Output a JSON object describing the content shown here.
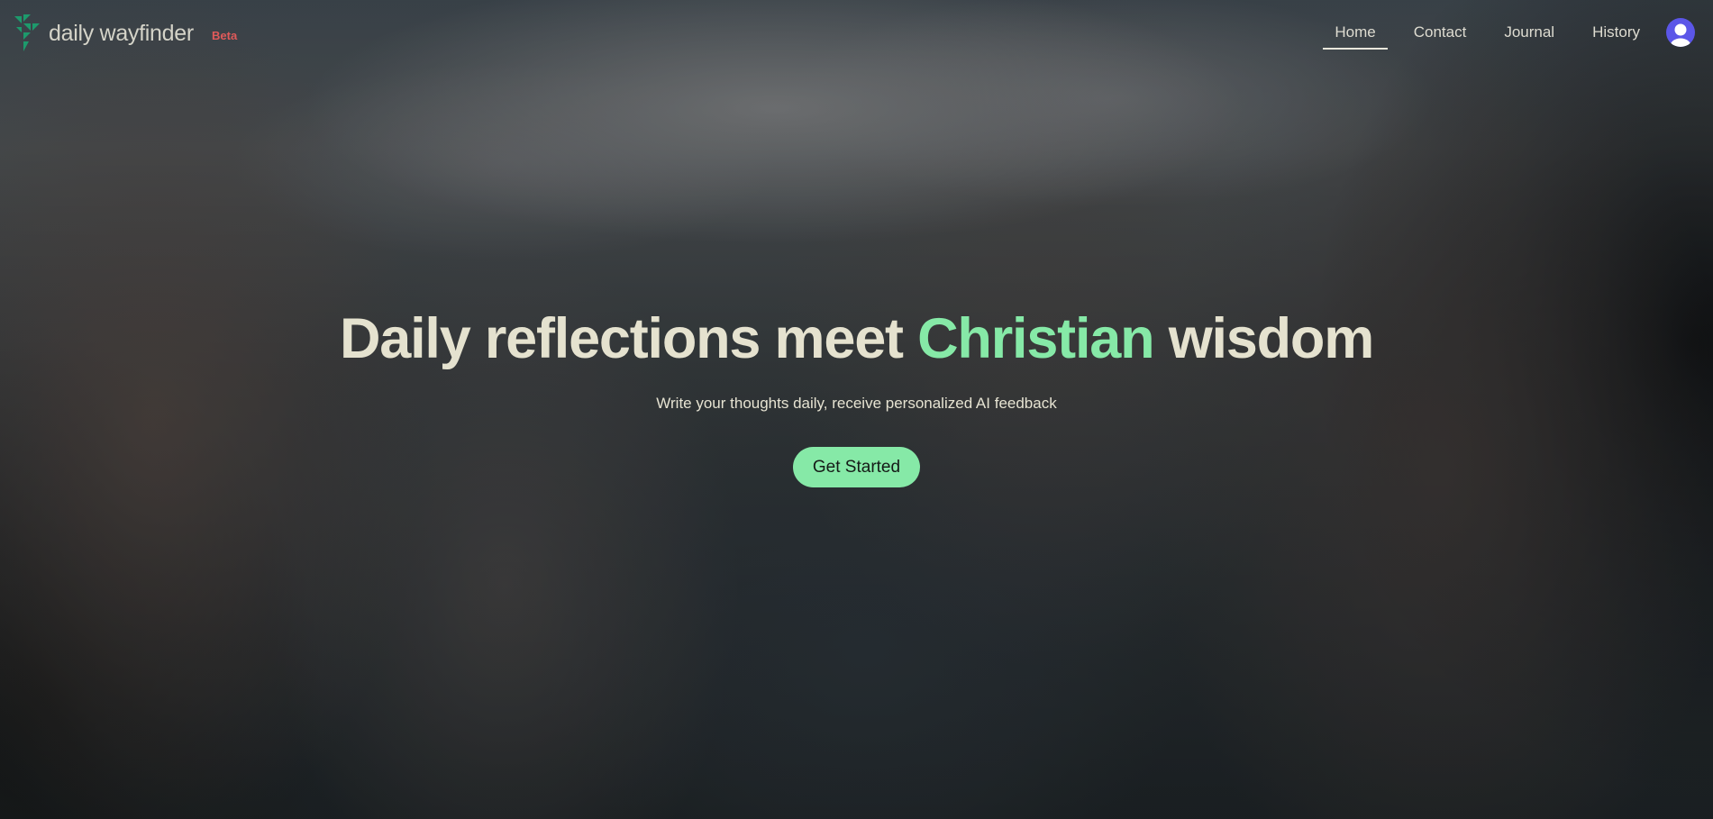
{
  "header": {
    "logo_text": "daily wayfinder",
    "beta_label": "Beta",
    "nav": [
      {
        "label": "Home",
        "active": true
      },
      {
        "label": "Contact",
        "active": false
      },
      {
        "label": "Journal",
        "active": false
      },
      {
        "label": "History",
        "active": false
      }
    ],
    "avatar_icon": "user-icon"
  },
  "hero": {
    "headline_part1": "Daily reflections meet ",
    "headline_accent": "Christian",
    "headline_part2": " wisdom",
    "subheadline": "Write your thoughts daily, receive personalized AI feedback",
    "cta_label": "Get Started"
  },
  "colors": {
    "accent": "#86e9a7",
    "headline_text": "#e5e2cf",
    "beta": "#e05a5a",
    "avatar": "#5b56e8",
    "logo_icon": "#1d9a6c"
  }
}
